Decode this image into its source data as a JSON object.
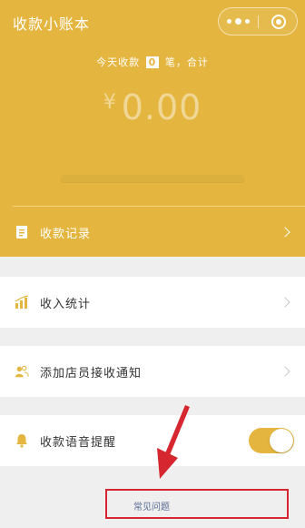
{
  "header": {
    "title": "收款小账本",
    "today_prefix": "今天收款",
    "today_count": "0",
    "today_suffix": "笔，合计",
    "currency": "¥",
    "amount": "0.00"
  },
  "capsule": {
    "more_icon": "more-dots-icon",
    "close_icon": "target-close-icon"
  },
  "menu": {
    "records": {
      "label": "收款记录",
      "icon": "receipt-icon"
    },
    "income": {
      "label": "收入统计",
      "icon": "bar-chart-icon"
    },
    "staff": {
      "label": "添加店员接收通知",
      "icon": "add-staff-icon"
    },
    "voice": {
      "label": "收款语音提醒",
      "icon": "bell-icon",
      "enabled": true
    }
  },
  "footer": {
    "faq_label": "常见问题"
  },
  "colors": {
    "brand": "#e4b63f",
    "annotation": "#d6262f",
    "link": "#596b95"
  }
}
